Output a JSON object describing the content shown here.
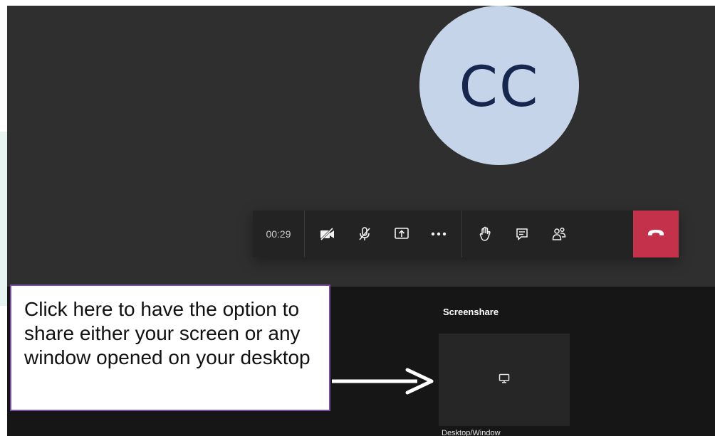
{
  "meeting": {
    "avatar_initials": "CC",
    "elapsed_time": "00:29"
  },
  "toolbar": {
    "buttons": [
      {
        "name": "camera-off",
        "icon": "camera-off-icon"
      },
      {
        "name": "mic-muted",
        "icon": "mic-muted-icon"
      },
      {
        "name": "share",
        "icon": "share-screen-icon"
      },
      {
        "name": "more",
        "icon": "more-options-icon"
      },
      {
        "name": "raise-hand",
        "icon": "raise-hand-icon"
      },
      {
        "name": "chat",
        "icon": "chat-icon"
      },
      {
        "name": "participants",
        "icon": "participants-icon"
      },
      {
        "name": "hang-up",
        "icon": "hang-up-icon"
      }
    ]
  },
  "share_panel": {
    "title": "Screenshare",
    "tile_label": "Desktop/Window"
  },
  "callout": {
    "text": "Click here to have the option to share either your screen or any window opened on your desktop"
  },
  "colors": {
    "stage_bg": "#2f2f2f",
    "toolbar_bg": "#232323",
    "hangup_red": "#c4314b",
    "avatar_bg": "#c5d4e9",
    "avatar_text": "#15264f",
    "callout_border": "#7a4d9e"
  }
}
